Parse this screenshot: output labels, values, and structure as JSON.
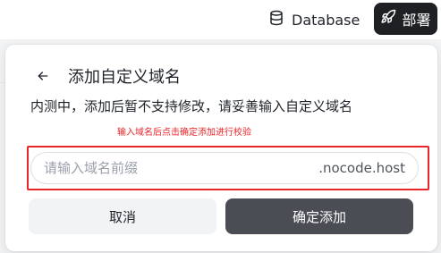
{
  "header": {
    "database_label": "Database",
    "database_icon": "database-icon",
    "deploy_label": "部署",
    "deploy_icon": "rocket-icon"
  },
  "dialog": {
    "title": "添加自定义域名",
    "back_icon": "arrow-left-icon",
    "description": "内测中，添加后暂不支持修改，请妥善输入自定义域名",
    "annotation": "输入域名后点击确定添加进行校验",
    "input": {
      "placeholder": "请输入域名前缀",
      "value": "",
      "suffix": ".nocode.host"
    },
    "cancel_label": "取消",
    "confirm_label": "确定添加"
  },
  "colors": {
    "accent_dark": "#1e2024",
    "confirm_button": "#4a4d54",
    "annotation_red": "#e8262a"
  }
}
